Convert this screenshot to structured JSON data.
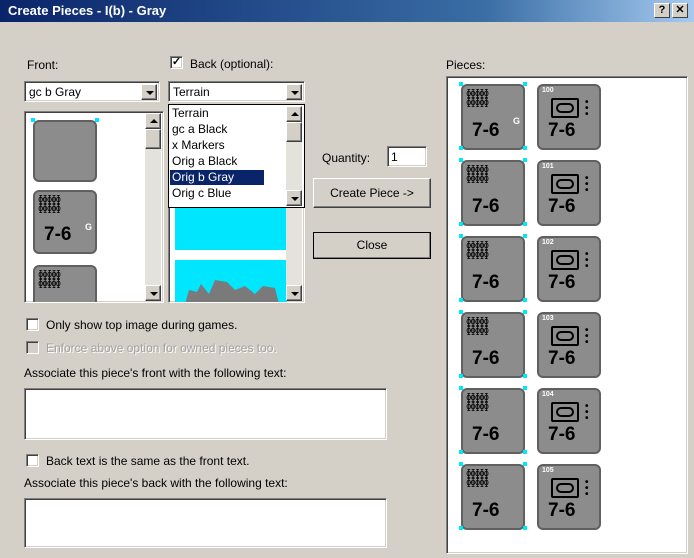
{
  "window": {
    "title": "Create Pieces - I(b) - Gray",
    "help_label": "?",
    "close_label": "✕"
  },
  "front": {
    "label": "Front:",
    "combo_value": "gc b Gray"
  },
  "back": {
    "label": "Back (optional):",
    "checked": true,
    "combo_value": "Terrain",
    "dropdown_items": [
      "Terrain",
      "gc a Black",
      "x Markers",
      "Orig a Black",
      "Orig b Gray",
      "Orig c Blue"
    ],
    "selected_index": 4
  },
  "quantity": {
    "label": "Quantity:",
    "value": "1"
  },
  "buttons": {
    "create_piece": "Create Piece ->",
    "close": "Close"
  },
  "pieces": {
    "label": "Pieces:",
    "counter_value": "7-6",
    "counter_superscript": "G",
    "marker_numbers": [
      "100",
      "101",
      "102",
      "103",
      "104",
      "105"
    ]
  },
  "options": {
    "only_top": "Only show top image during games.",
    "enforce": "Enforce above option for owned pieces too.",
    "front_text_label": "Associate this piece's front with the following text:",
    "back_same": "Back text is the same as the front text.",
    "back_text_label": "Associate this piece's back with the following text:"
  },
  "colors": {
    "title_bar": "#0a246a",
    "selection": "#0a246a",
    "piece_bg": "#8c8c8c",
    "terrain_cyan": "#00e6ff",
    "dialog_bg": "#d4d0c8"
  }
}
